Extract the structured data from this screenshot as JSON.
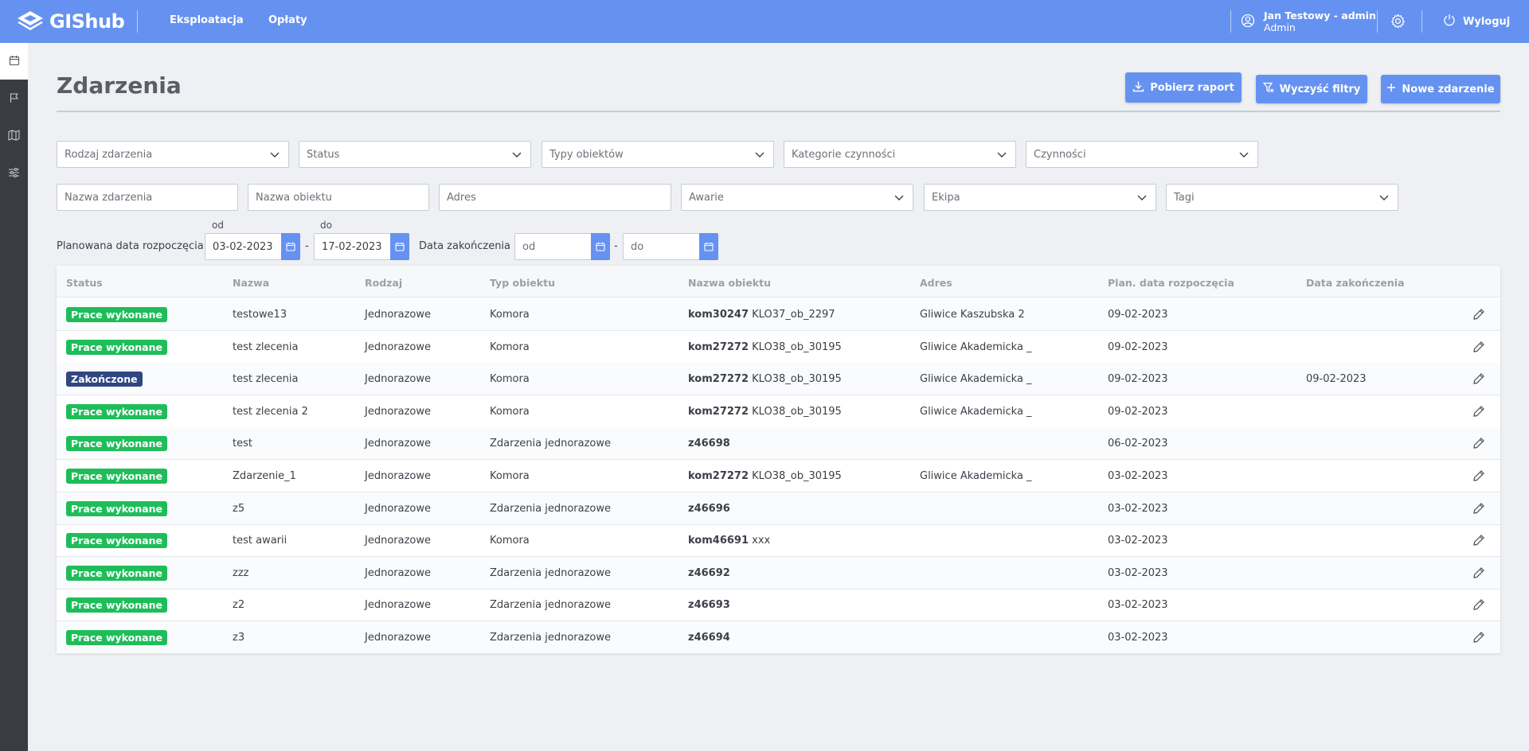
{
  "app": {
    "name": "GIShub"
  },
  "nav": {
    "items": [
      {
        "label": "Eksploatacja"
      },
      {
        "label": "Opłaty"
      }
    ]
  },
  "user": {
    "name": "Jan Testowy - admin",
    "role": "Admin",
    "logout_label": "Wyloguj"
  },
  "colors": {
    "primary": "#6592f0",
    "sidebar": "#3a3c42",
    "status_done_work": "#1fbd5a",
    "status_finished": "#2f4680"
  },
  "sidebar": {
    "items": [
      {
        "icon": "calendar-icon"
      },
      {
        "icon": "flag-icon"
      },
      {
        "icon": "map-icon"
      },
      {
        "icon": "sliders-icon"
      }
    ]
  },
  "page": {
    "title": "Zdarzenia"
  },
  "actions": {
    "download_report": "Pobierz raport",
    "clear_filters": "Wyczyść filtry",
    "new_event": "Nowe zdarzenie"
  },
  "filters": {
    "event_type": "Rodzaj zdarzenia",
    "status": "Status",
    "object_types": "Typy obiektów",
    "activity_categories": "Kategorie czynności",
    "activities": "Czynności",
    "event_name": "Nazwa zdarzenia",
    "object_name": "Nazwa obiektu",
    "address": "Adres",
    "failures": "Awarie",
    "crew": "Ekipa",
    "tags": "Tagi",
    "planned_start_label": "Planowana data rozpoczęcia",
    "from_label": "od",
    "to_label": "do",
    "planned_from": "03-02-2023",
    "planned_to": "17-02-2023",
    "end_date_label": "Data zakończenia",
    "end_from_placeholder": "od",
    "end_to_placeholder": "do",
    "separator": "-"
  },
  "table": {
    "columns": [
      "Status",
      "Nazwa",
      "Rodzaj",
      "Typ obiektu",
      "Nazwa obiektu",
      "Adres",
      "Plan. data rozpoczęcia",
      "Data zakończenia"
    ],
    "rows": [
      {
        "status": "Prace wykonane",
        "status_kind": "green",
        "name": "testowe13",
        "kind": "Jednorazowe",
        "object_type": "Komora",
        "object_code": "kom30247",
        "object_label": "KLO37_ob_2297",
        "address": "Gliwice Kaszubska 2",
        "planned_start": "09-02-2023",
        "end_date": ""
      },
      {
        "status": "Prace wykonane",
        "status_kind": "green",
        "name": "test zlecenia",
        "kind": "Jednorazowe",
        "object_type": "Komora",
        "object_code": "kom27272",
        "object_label": "KLO38_ob_30195",
        "address": "Gliwice Akademicka _",
        "planned_start": "09-02-2023",
        "end_date": ""
      },
      {
        "status": "Zakończone",
        "status_kind": "navy",
        "name": "test zlecenia",
        "kind": "Jednorazowe",
        "object_type": "Komora",
        "object_code": "kom27272",
        "object_label": "KLO38_ob_30195",
        "address": "Gliwice Akademicka _",
        "planned_start": "09-02-2023",
        "end_date": "09-02-2023"
      },
      {
        "status": "Prace wykonane",
        "status_kind": "green",
        "name": "test zlecenia 2",
        "kind": "Jednorazowe",
        "object_type": "Komora",
        "object_code": "kom27272",
        "object_label": "KLO38_ob_30195",
        "address": "Gliwice Akademicka _",
        "planned_start": "09-02-2023",
        "end_date": ""
      },
      {
        "status": "Prace wykonane",
        "status_kind": "green",
        "name": "test",
        "kind": "Jednorazowe",
        "object_type": "Zdarzenia jednorazowe",
        "object_code": "z46698",
        "object_label": "",
        "address": "",
        "planned_start": "06-02-2023",
        "end_date": ""
      },
      {
        "status": "Prace wykonane",
        "status_kind": "green",
        "name": "Zdarzenie_1",
        "kind": "Jednorazowe",
        "object_type": "Komora",
        "object_code": "kom27272",
        "object_label": "KLO38_ob_30195",
        "address": "Gliwice Akademicka _",
        "planned_start": "03-02-2023",
        "end_date": ""
      },
      {
        "status": "Prace wykonane",
        "status_kind": "green",
        "name": "z5",
        "kind": "Jednorazowe",
        "object_type": "Zdarzenia jednorazowe",
        "object_code": "z46696",
        "object_label": "",
        "address": "",
        "planned_start": "03-02-2023",
        "end_date": ""
      },
      {
        "status": "Prace wykonane",
        "status_kind": "green",
        "name": "test awarii",
        "kind": "Jednorazowe",
        "object_type": "Komora",
        "object_code": "kom46691",
        "object_label": "xxx",
        "address": "",
        "planned_start": "03-02-2023",
        "end_date": ""
      },
      {
        "status": "Prace wykonane",
        "status_kind": "green",
        "name": "zzz",
        "kind": "Jednorazowe",
        "object_type": "Zdarzenia jednorazowe",
        "object_code": "z46692",
        "object_label": "",
        "address": "",
        "planned_start": "03-02-2023",
        "end_date": ""
      },
      {
        "status": "Prace wykonane",
        "status_kind": "green",
        "name": "z2",
        "kind": "Jednorazowe",
        "object_type": "Zdarzenia jednorazowe",
        "object_code": "z46693",
        "object_label": "",
        "address": "",
        "planned_start": "03-02-2023",
        "end_date": ""
      },
      {
        "status": "Prace wykonane",
        "status_kind": "green",
        "name": "z3",
        "kind": "Jednorazowe",
        "object_type": "Zdarzenia jednorazowe",
        "object_code": "z46694",
        "object_label": "",
        "address": "",
        "planned_start": "03-02-2023",
        "end_date": ""
      }
    ]
  }
}
